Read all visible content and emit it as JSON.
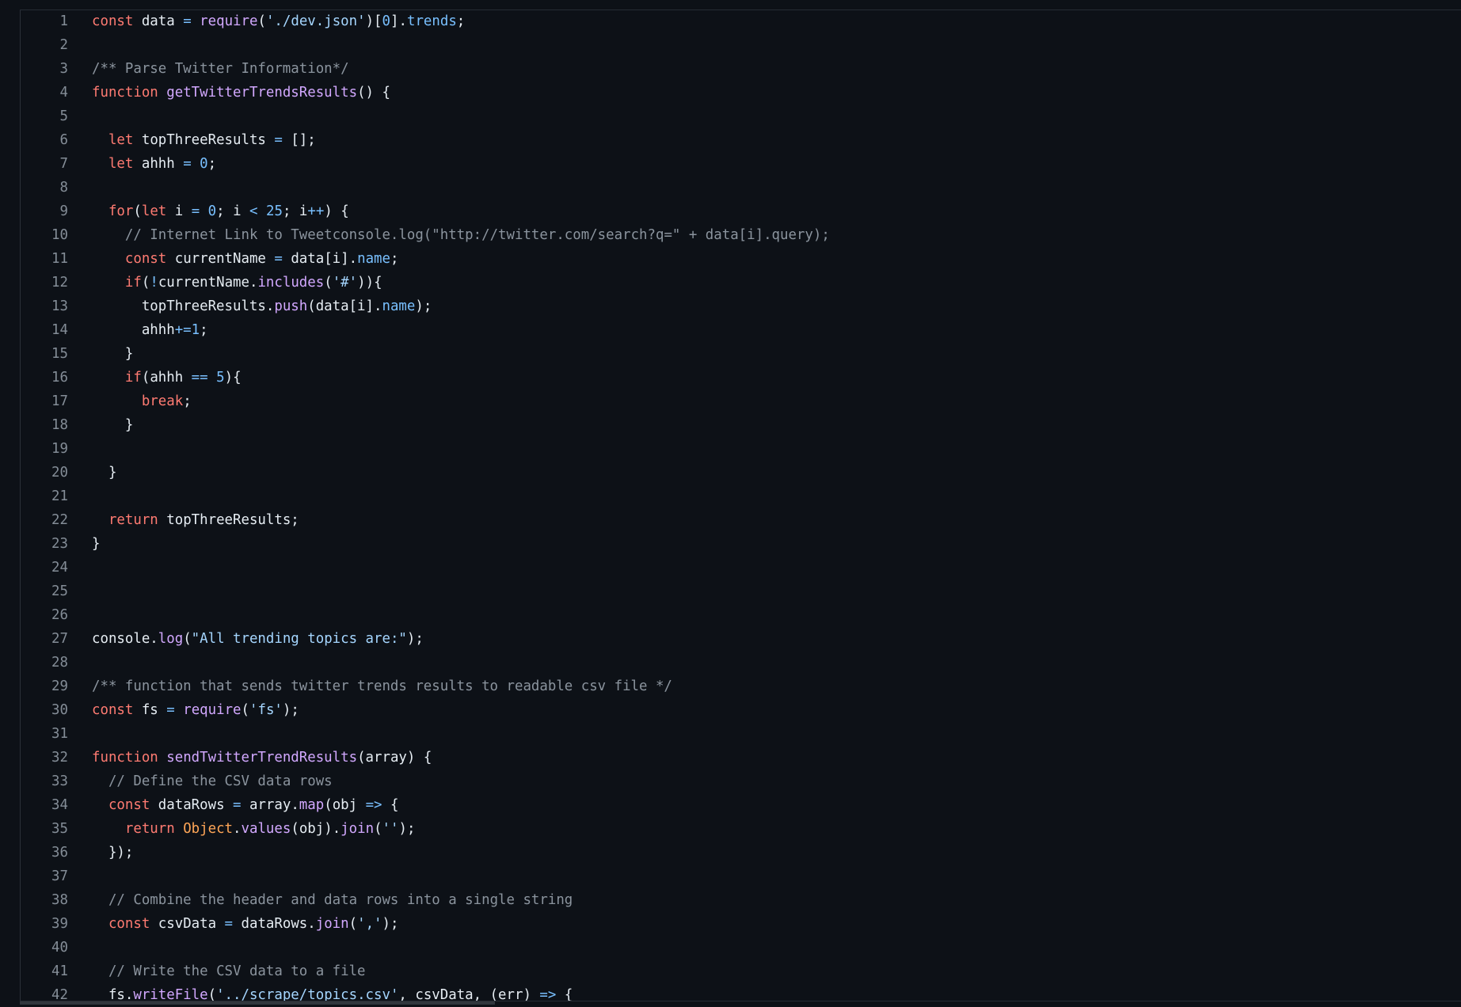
{
  "editor": {
    "lines": [
      {
        "n": "1",
        "t": [
          [
            "kw",
            "const"
          ],
          [
            "pl",
            " data "
          ],
          [
            "op",
            "="
          ],
          [
            "pl",
            " "
          ],
          [
            "fn",
            "require"
          ],
          [
            "pl",
            "("
          ],
          [
            "str",
            "'./dev.json'"
          ],
          [
            "pl",
            ")["
          ],
          [
            "num",
            "0"
          ],
          [
            "pl",
            "]."
          ],
          [
            "prop",
            "trends"
          ],
          [
            "pl",
            ";"
          ]
        ]
      },
      {
        "n": "2",
        "t": []
      },
      {
        "n": "3",
        "t": [
          [
            "cm",
            "/** Parse Twitter Information*/"
          ]
        ]
      },
      {
        "n": "4",
        "t": [
          [
            "kw",
            "function"
          ],
          [
            "pl",
            " "
          ],
          [
            "fn",
            "getTwitterTrendsResults"
          ],
          [
            "pl",
            "() {"
          ]
        ]
      },
      {
        "n": "5",
        "t": []
      },
      {
        "n": "6",
        "t": [
          [
            "pl",
            "  "
          ],
          [
            "kw",
            "let"
          ],
          [
            "pl",
            " topThreeResults "
          ],
          [
            "op",
            "="
          ],
          [
            "pl",
            " [];"
          ]
        ]
      },
      {
        "n": "7",
        "t": [
          [
            "pl",
            "  "
          ],
          [
            "kw",
            "let"
          ],
          [
            "pl",
            " ahhh "
          ],
          [
            "op",
            "="
          ],
          [
            "pl",
            " "
          ],
          [
            "num",
            "0"
          ],
          [
            "pl",
            ";"
          ]
        ]
      },
      {
        "n": "8",
        "t": []
      },
      {
        "n": "9",
        "t": [
          [
            "pl",
            "  "
          ],
          [
            "kw",
            "for"
          ],
          [
            "pl",
            "("
          ],
          [
            "kw",
            "let"
          ],
          [
            "pl",
            " i "
          ],
          [
            "op",
            "="
          ],
          [
            "pl",
            " "
          ],
          [
            "num",
            "0"
          ],
          [
            "pl",
            "; i "
          ],
          [
            "op",
            "<"
          ],
          [
            "pl",
            " "
          ],
          [
            "num",
            "25"
          ],
          [
            "pl",
            "; i"
          ],
          [
            "op",
            "++"
          ],
          [
            "pl",
            ") {"
          ]
        ]
      },
      {
        "n": "10",
        "t": [
          [
            "pl",
            "    "
          ],
          [
            "cm",
            "// Internet Link to Tweetconsole.log(\"http://twitter.com/search?q=\" + data[i].query);"
          ]
        ]
      },
      {
        "n": "11",
        "t": [
          [
            "pl",
            "    "
          ],
          [
            "kw",
            "const"
          ],
          [
            "pl",
            " currentName "
          ],
          [
            "op",
            "="
          ],
          [
            "pl",
            " data[i]."
          ],
          [
            "prop",
            "name"
          ],
          [
            "pl",
            ";"
          ]
        ]
      },
      {
        "n": "12",
        "t": [
          [
            "pl",
            "    "
          ],
          [
            "kw",
            "if"
          ],
          [
            "pl",
            "("
          ],
          [
            "op",
            "!"
          ],
          [
            "pl",
            "currentName."
          ],
          [
            "fn",
            "includes"
          ],
          [
            "pl",
            "("
          ],
          [
            "str",
            "'#'"
          ],
          [
            "pl",
            ")){"
          ]
        ]
      },
      {
        "n": "13",
        "t": [
          [
            "pl",
            "      topThreeResults."
          ],
          [
            "fn",
            "push"
          ],
          [
            "pl",
            "(data[i]."
          ],
          [
            "prop",
            "name"
          ],
          [
            "pl",
            ");"
          ]
        ]
      },
      {
        "n": "14",
        "t": [
          [
            "pl",
            "      ahhh"
          ],
          [
            "op",
            "+="
          ],
          [
            "num",
            "1"
          ],
          [
            "pl",
            ";"
          ]
        ]
      },
      {
        "n": "15",
        "t": [
          [
            "pl",
            "    }"
          ]
        ]
      },
      {
        "n": "16",
        "t": [
          [
            "pl",
            "    "
          ],
          [
            "kw",
            "if"
          ],
          [
            "pl",
            "(ahhh "
          ],
          [
            "op",
            "=="
          ],
          [
            "pl",
            " "
          ],
          [
            "num",
            "5"
          ],
          [
            "pl",
            "){"
          ]
        ]
      },
      {
        "n": "17",
        "t": [
          [
            "pl",
            "      "
          ],
          [
            "kw",
            "break"
          ],
          [
            "pl",
            ";"
          ]
        ]
      },
      {
        "n": "18",
        "t": [
          [
            "pl",
            "    }"
          ]
        ]
      },
      {
        "n": "19",
        "t": []
      },
      {
        "n": "20",
        "t": [
          [
            "pl",
            "  }"
          ]
        ]
      },
      {
        "n": "21",
        "t": []
      },
      {
        "n": "22",
        "t": [
          [
            "pl",
            "  "
          ],
          [
            "kw",
            "return"
          ],
          [
            "pl",
            " topThreeResults;"
          ]
        ]
      },
      {
        "n": "23",
        "t": [
          [
            "pl",
            "}"
          ]
        ]
      },
      {
        "n": "24",
        "t": []
      },
      {
        "n": "25",
        "t": []
      },
      {
        "n": "26",
        "t": []
      },
      {
        "n": "27",
        "t": [
          [
            "pl",
            "console."
          ],
          [
            "fn",
            "log"
          ],
          [
            "pl",
            "("
          ],
          [
            "str",
            "\"All trending topics are:\""
          ],
          [
            "pl",
            ");"
          ]
        ]
      },
      {
        "n": "28",
        "t": []
      },
      {
        "n": "29",
        "t": [
          [
            "cm",
            "/** function that sends twitter trends results to readable csv file */"
          ]
        ]
      },
      {
        "n": "30",
        "t": [
          [
            "kw",
            "const"
          ],
          [
            "pl",
            " fs "
          ],
          [
            "op",
            "="
          ],
          [
            "pl",
            " "
          ],
          [
            "fn",
            "require"
          ],
          [
            "pl",
            "("
          ],
          [
            "str",
            "'fs'"
          ],
          [
            "pl",
            ");"
          ]
        ]
      },
      {
        "n": "31",
        "t": []
      },
      {
        "n": "32",
        "t": [
          [
            "kw",
            "function"
          ],
          [
            "pl",
            " "
          ],
          [
            "fn",
            "sendTwitterTrendResults"
          ],
          [
            "pl",
            "(array) {"
          ]
        ]
      },
      {
        "n": "33",
        "t": [
          [
            "pl",
            "  "
          ],
          [
            "cm",
            "// Define the CSV data rows"
          ]
        ]
      },
      {
        "n": "34",
        "t": [
          [
            "pl",
            "  "
          ],
          [
            "kw",
            "const"
          ],
          [
            "pl",
            " dataRows "
          ],
          [
            "op",
            "="
          ],
          [
            "pl",
            " array."
          ],
          [
            "fn",
            "map"
          ],
          [
            "pl",
            "(obj "
          ],
          [
            "op",
            "=>"
          ],
          [
            "pl",
            " {"
          ]
        ]
      },
      {
        "n": "35",
        "t": [
          [
            "pl",
            "    "
          ],
          [
            "kw",
            "return"
          ],
          [
            "pl",
            " "
          ],
          [
            "cls",
            "Object"
          ],
          [
            "pl",
            "."
          ],
          [
            "fn",
            "values"
          ],
          [
            "pl",
            "(obj)."
          ],
          [
            "fn",
            "join"
          ],
          [
            "pl",
            "("
          ],
          [
            "str",
            "''"
          ],
          [
            "pl",
            ");"
          ]
        ]
      },
      {
        "n": "36",
        "t": [
          [
            "pl",
            "  });"
          ]
        ]
      },
      {
        "n": "37",
        "t": []
      },
      {
        "n": "38",
        "t": [
          [
            "pl",
            "  "
          ],
          [
            "cm",
            "// Combine the header and data rows into a single string"
          ]
        ]
      },
      {
        "n": "39",
        "t": [
          [
            "pl",
            "  "
          ],
          [
            "kw",
            "const"
          ],
          [
            "pl",
            " csvData "
          ],
          [
            "op",
            "="
          ],
          [
            "pl",
            " dataRows."
          ],
          [
            "fn",
            "join"
          ],
          [
            "pl",
            "("
          ],
          [
            "str",
            "','"
          ],
          [
            "pl",
            ");"
          ]
        ]
      },
      {
        "n": "40",
        "t": []
      },
      {
        "n": "41",
        "t": [
          [
            "pl",
            "  "
          ],
          [
            "cm",
            "// Write the CSV data to a file"
          ]
        ]
      },
      {
        "n": "42",
        "t": [
          [
            "pl",
            "  fs."
          ],
          [
            "fn",
            "writeFile"
          ],
          [
            "pl",
            "("
          ],
          [
            "str",
            "'../scrape/topics.csv'"
          ],
          [
            "pl",
            ", csvData, (err) "
          ],
          [
            "op",
            "=>"
          ],
          [
            "pl",
            " {"
          ]
        ]
      }
    ]
  }
}
